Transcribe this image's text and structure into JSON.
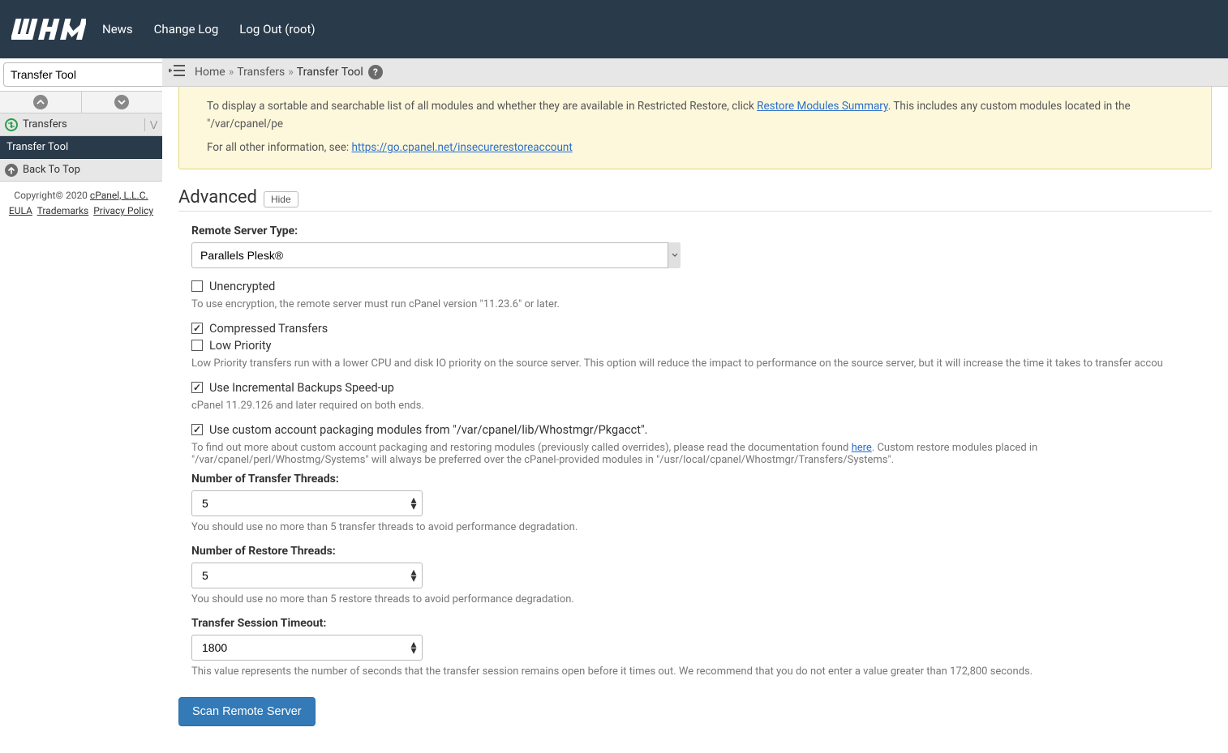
{
  "topnav": {
    "news": "News",
    "changelog": "Change Log",
    "logout": "Log Out (root)"
  },
  "search": {
    "value": "Transfer Tool"
  },
  "sidebar": {
    "category": "Transfers",
    "active_item": "Transfer Tool",
    "backtop": "Back To Top"
  },
  "footer": {
    "copyright": "Copyright© 2020 ",
    "company": "cPanel, L.L.C.",
    "eula": "EULA",
    "trademarks": "Trademarks",
    "privacy": "Privacy Policy"
  },
  "breadcrumb": {
    "home": "Home",
    "transfers": "Transfers",
    "current": "Transfer Tool"
  },
  "infobox": {
    "line1a": "To display a sortable and searchable list of all modules and whether they are available in Restricted Restore, click ",
    "line1link": "Restore Modules Summary",
    "line1b": ". This includes any custom modules located in the \"/var/cpanel/pe",
    "line2a": "For all other information, see: ",
    "line2link": "https://go.cpanel.net/insecurerestoreaccount"
  },
  "section": {
    "title": "Advanced",
    "hide": "Hide"
  },
  "form": {
    "remote_type": {
      "label": "Remote Server Type:",
      "value": "Parallels Plesk®"
    },
    "unencrypted": {
      "label": "Unencrypted",
      "help": "To use encryption, the remote server must run cPanel version \"11.23.6\" or later."
    },
    "compressed": {
      "label": "Compressed Transfers"
    },
    "lowpriority": {
      "label": "Low Priority",
      "help": "Low Priority transfers run with a lower CPU and disk IO priority on the source server. This option will reduce the impact to performance on the source server, but it will increase the time it takes to transfer accou"
    },
    "incremental": {
      "label": "Use Incremental Backups Speed-up",
      "help": "cPanel 11.29.126 and later required on both ends."
    },
    "custommods": {
      "label": "Use custom account packaging modules from \"/var/cpanel/lib/Whostmgr/Pkgacct\".",
      "help_a": "To find out more about custom account packaging and restoring modules (previously called overrides), please read the documentation found ",
      "help_link": "here",
      "help_b": ". Custom restore modules placed in \"/var/cpanel/perl/Whostmg/Systems\" will always be preferred over the cPanel-provided modules in \"/usr/local/cpanel/Whostmgr/Transfers/Systems\"."
    },
    "transfer_threads": {
      "label": "Number of Transfer Threads:",
      "value": "5",
      "help": "You should use no more than 5 transfer threads to avoid performance degradation."
    },
    "restore_threads": {
      "label": "Number of Restore Threads:",
      "value": "5",
      "help": "You should use no more than 5 restore threads to avoid performance degradation."
    },
    "timeout": {
      "label": "Transfer Session Timeout:",
      "value": "1800",
      "help": "This value represents the number of seconds that the transfer session remains open before it times out. We recommend that you do not enter a value greater than 172,800 seconds."
    },
    "scan": "Scan Remote Server"
  }
}
